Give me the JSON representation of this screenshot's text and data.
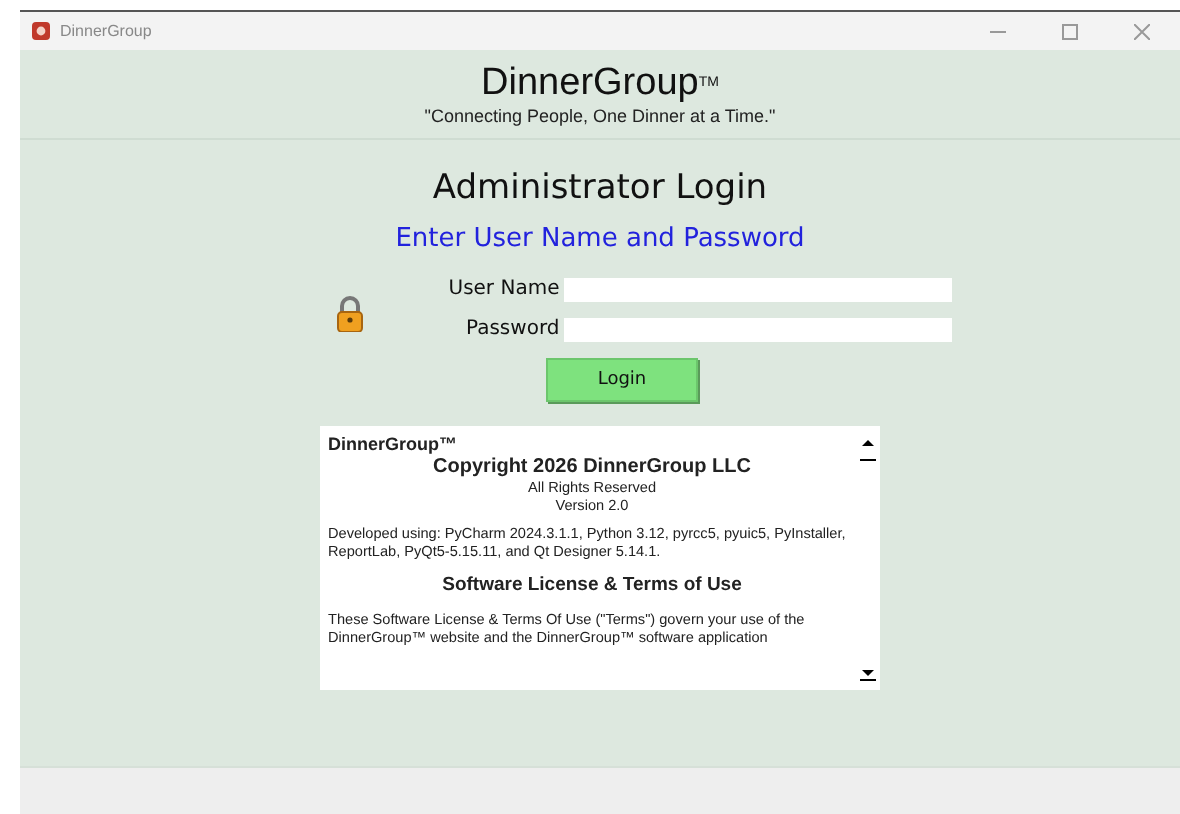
{
  "window": {
    "title": "DinnerGroup"
  },
  "header": {
    "brand": "DinnerGroup",
    "trademark": "TM",
    "tagline": "\"Connecting People, One Dinner at a Time.\""
  },
  "login": {
    "title": "Administrator Login",
    "subtitle": "Enter User Name and Password",
    "fields": [
      {
        "label": "User Name"
      },
      {
        "label": "Password"
      }
    ],
    "button": "Login"
  },
  "license": {
    "paragraphs": [
      {
        "kind": "brand",
        "text": "DinnerGroup™"
      },
      {
        "kind": "heading",
        "text": "Copyright 2026 DinnerGroup LLC"
      },
      {
        "kind": "center",
        "text": "All Rights Reserved"
      },
      {
        "kind": "center",
        "text": "Version 2.0"
      },
      {
        "kind": "body",
        "text": "Developed using: PyCharm 2024.3.1.1, Python 3.12, pyrcc5, pyuic5, PyInstaller, ReportLab,  PyQt5-5.15.11, and Qt Designer 5.14.1."
      },
      {
        "kind": "section",
        "text": "Software License & Terms of Use"
      },
      {
        "kind": "body",
        "text": "These Software License & Terms Of Use (\"Terms\") govern your use of the DinnerGroup™ website and the DinnerGroup™ software application"
      }
    ]
  }
}
